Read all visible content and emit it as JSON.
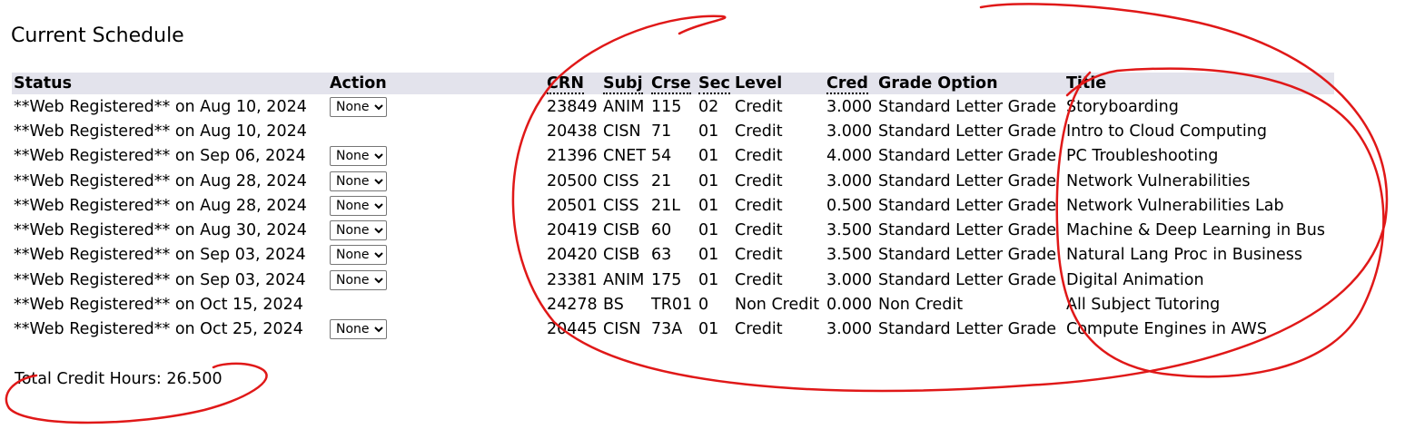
{
  "page_title": "Current Schedule",
  "headers": {
    "status": "Status",
    "action": "Action",
    "crn": "CRN",
    "subj": "Subj",
    "crse": "Crse",
    "sec": "Sec",
    "level": "Level",
    "cred": "Cred",
    "grade_option": "Grade Option",
    "title": "Title"
  },
  "rows": [
    {
      "status": "**Web Registered** on Aug 10, 2024",
      "action": "None",
      "crn": "23849",
      "subj": "ANIM",
      "crse": "115",
      "sec": "02",
      "level": "Credit",
      "cred": "3.000",
      "grade_option": "Standard Letter Grade",
      "title": "Storyboarding"
    },
    {
      "status": "**Web Registered** on Aug 10, 2024",
      "action": "",
      "crn": "20438",
      "subj": "CISN",
      "crse": "71",
      "sec": "01",
      "level": "Credit",
      "cred": "3.000",
      "grade_option": "Standard Letter Grade",
      "title": "Intro to Cloud Computing"
    },
    {
      "status": "**Web Registered** on Sep 06, 2024",
      "action": "None",
      "crn": "21396",
      "subj": "CNET",
      "crse": "54",
      "sec": "01",
      "level": "Credit",
      "cred": "4.000",
      "grade_option": "Standard Letter Grade",
      "title": "PC Troubleshooting"
    },
    {
      "status": "**Web Registered** on Aug 28, 2024",
      "action": "None",
      "crn": "20500",
      "subj": "CISS",
      "crse": "21",
      "sec": "01",
      "level": "Credit",
      "cred": "3.000",
      "grade_option": "Standard Letter Grade",
      "title": "Network Vulnerabilities"
    },
    {
      "status": "**Web Registered** on Aug 28, 2024",
      "action": "None",
      "crn": "20501",
      "subj": "CISS",
      "crse": "21L",
      "sec": "01",
      "level": "Credit",
      "cred": "0.500",
      "grade_option": "Standard Letter Grade",
      "title": "Network Vulnerabilities Lab"
    },
    {
      "status": "**Web Registered** on Aug 30, 2024",
      "action": "None",
      "crn": "20419",
      "subj": "CISB",
      "crse": "60",
      "sec": "01",
      "level": "Credit",
      "cred": "3.500",
      "grade_option": "Standard Letter Grade",
      "title": "Machine & Deep Learning in Bus"
    },
    {
      "status": "**Web Registered** on Sep 03, 2024",
      "action": "None",
      "crn": "20420",
      "subj": "CISB",
      "crse": "63",
      "sec": "01",
      "level": "Credit",
      "cred": "3.500",
      "grade_option": "Standard Letter Grade",
      "title": "Natural Lang Proc in Business"
    },
    {
      "status": "**Web Registered** on Sep 03, 2024",
      "action": "None",
      "crn": "23381",
      "subj": "ANIM",
      "crse": "175",
      "sec": "01",
      "level": "Credit",
      "cred": "3.000",
      "grade_option": "Standard Letter Grade",
      "title": "Digital Animation"
    },
    {
      "status": "**Web Registered** on Oct 15, 2024",
      "action": "",
      "crn": "24278",
      "subj": "BS",
      "crse": "TR01",
      "sec": "0",
      "level": "Non Credit",
      "cred": "0.000",
      "grade_option": "Non Credit",
      "title": "All Subject Tutoring"
    },
    {
      "status": "**Web Registered** on Oct 25, 2024",
      "action": "None",
      "crn": "20445",
      "subj": "CISN",
      "crse": "73A",
      "sec": "01",
      "level": "Credit",
      "cred": "3.000",
      "grade_option": "Standard Letter Grade",
      "title": "Compute Engines in AWS"
    }
  ],
  "total_credit_hours": "Total Credit Hours: 26.500",
  "annotation_color": "#e01818"
}
